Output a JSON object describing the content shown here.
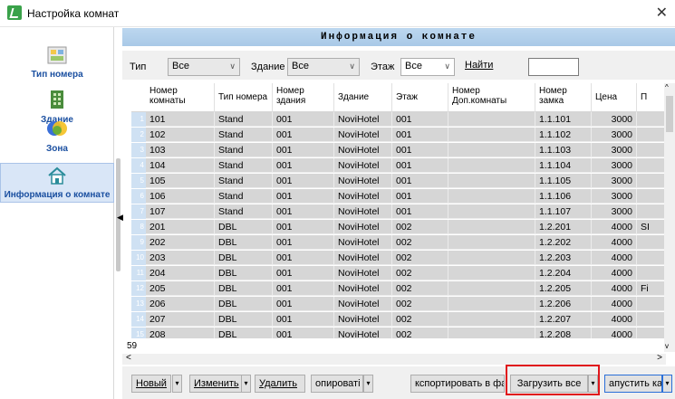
{
  "window": {
    "title": "Настройка комнат",
    "close_glyph": "✕"
  },
  "sidebar": {
    "items": [
      {
        "label": "Тип номера",
        "icon": "room-type-icon"
      },
      {
        "label": "Здание",
        "icon": "building-icon"
      },
      {
        "label": "Зона",
        "icon": "zone-icon"
      },
      {
        "label": "Информация о комнате",
        "icon": "house-icon",
        "active": true
      }
    ]
  },
  "header": {
    "title": "Информация о комнате"
  },
  "filters": {
    "type_label": "Тип",
    "type_value": "Все",
    "building_label": "Здание",
    "building_value": "Все",
    "floor_label": "Этаж",
    "floor_value": "Все",
    "find_label": "Найти",
    "find_value": ""
  },
  "table": {
    "columns": [
      "Номер комнаты",
      "Тип номера",
      "Номер здания",
      "Здание",
      "Этаж",
      "Номер Доп.комнаты",
      "Номер замка",
      "Цена",
      "П"
    ],
    "rows": [
      [
        "1",
        "101",
        "Stand",
        "001",
        "NoviHotel",
        "001",
        "",
        "1.1.101",
        "3000",
        ""
      ],
      [
        "2",
        "102",
        "Stand",
        "001",
        "NoviHotel",
        "001",
        "",
        "1.1.102",
        "3000",
        ""
      ],
      [
        "3",
        "103",
        "Stand",
        "001",
        "NoviHotel",
        "001",
        "",
        "1.1.103",
        "3000",
        ""
      ],
      [
        "4",
        "104",
        "Stand",
        "001",
        "NoviHotel",
        "001",
        "",
        "1.1.104",
        "3000",
        ""
      ],
      [
        "5",
        "105",
        "Stand",
        "001",
        "NoviHotel",
        "001",
        "",
        "1.1.105",
        "3000",
        ""
      ],
      [
        "6",
        "106",
        "Stand",
        "001",
        "NoviHotel",
        "001",
        "",
        "1.1.106",
        "3000",
        ""
      ],
      [
        "7",
        "107",
        "Stand",
        "001",
        "NoviHotel",
        "001",
        "",
        "1.1.107",
        "3000",
        ""
      ],
      [
        "8",
        "201",
        "DBL",
        "001",
        "NoviHotel",
        "002",
        "",
        "1.2.201",
        "4000",
        "SI"
      ],
      [
        "9",
        "202",
        "DBL",
        "001",
        "NoviHotel",
        "002",
        "",
        "1.2.202",
        "4000",
        ""
      ],
      [
        "10",
        "203",
        "DBL",
        "001",
        "NoviHotel",
        "002",
        "",
        "1.2.203",
        "4000",
        ""
      ],
      [
        "11",
        "204",
        "DBL",
        "001",
        "NoviHotel",
        "002",
        "",
        "1.2.204",
        "4000",
        ""
      ],
      [
        "12",
        "205",
        "DBL",
        "001",
        "NoviHotel",
        "002",
        "",
        "1.2.205",
        "4000",
        "Fi"
      ],
      [
        "13",
        "206",
        "DBL",
        "001",
        "NoviHotel",
        "002",
        "",
        "1.2.206",
        "4000",
        ""
      ],
      [
        "14",
        "207",
        "DBL",
        "001",
        "NoviHotel",
        "002",
        "",
        "1.2.207",
        "4000",
        ""
      ],
      [
        "15",
        "208",
        "DBL",
        "001",
        "NoviHotel",
        "002",
        "",
        "1.2.208",
        "4000",
        ""
      ]
    ],
    "total_count": "59"
  },
  "buttons": {
    "new": "Новый",
    "edit": "Изменить",
    "delete": "Удалить",
    "copy": "опироваті",
    "export": "кспортировать в фай",
    "load_all": "Загрузить все",
    "run_card": "апустить кар"
  },
  "colors": {
    "highlight": "#e0161b",
    "header_band": "#bcd7ef",
    "row_bg": "#d6d6d6"
  }
}
